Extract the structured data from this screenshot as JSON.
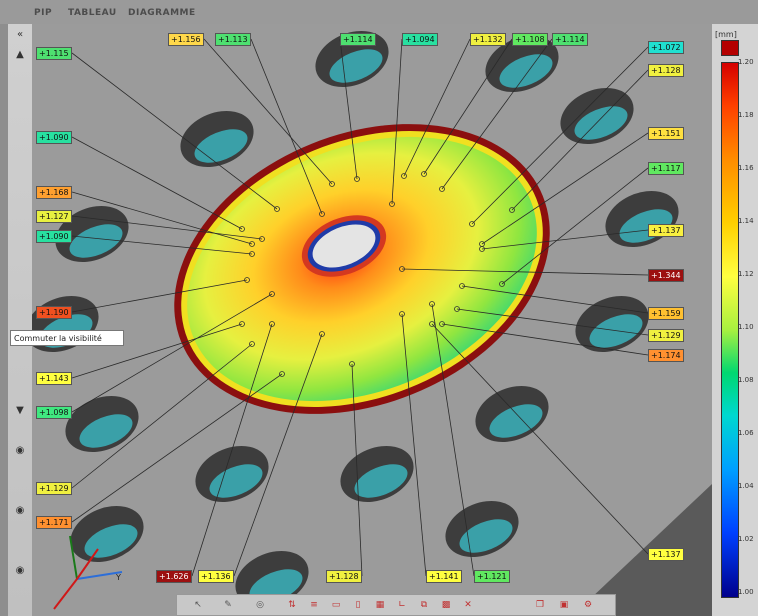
{
  "tabs": [
    "PIP",
    "TABLEAU",
    "DIAGRAMME"
  ],
  "legend": {
    "unit": "[mm]",
    "ticks": [
      "1.20",
      "1.18",
      "1.16",
      "1.14",
      "1.12",
      "1.10",
      "1.08",
      "1.06",
      "1.04",
      "1.02",
      "1.00"
    ],
    "max_swatch_color": "#b40000",
    "min_swatch_color": "#00008c"
  },
  "tooltip": {
    "text": "Commuter la visibilité"
  },
  "axis_label": "Y",
  "labels": [
    {
      "text": "+1.156",
      "color": "#ffd84a"
    },
    {
      "text": "+1.113",
      "color": "#4ee070"
    },
    {
      "text": "+1.114",
      "color": "#4ee070"
    },
    {
      "text": "+1.094",
      "color": "#28e0a0"
    },
    {
      "text": "+1.132",
      "color": "#f0f040"
    },
    {
      "text": "+1.108",
      "color": "#60e860"
    },
    {
      "text": "+1.114",
      "color": "#4ee070"
    },
    {
      "text": "+1.072",
      "color": "#20e0d0"
    },
    {
      "text": "+1.115",
      "color": "#4ee070"
    },
    {
      "text": "+1.128",
      "color": "#f0f040"
    },
    {
      "text": "+1.151",
      "color": "#ffe040"
    },
    {
      "text": "+1.090",
      "color": "#28e0a0"
    },
    {
      "text": "+1.117",
      "color": "#60e860"
    },
    {
      "text": "+1.168",
      "color": "#ffa030"
    },
    {
      "text": "+1.127",
      "color": "#e8f040"
    },
    {
      "text": "+1.090",
      "color": "#28e0a0"
    },
    {
      "text": "+1.137",
      "color": "#f8f040"
    },
    {
      "text": "+1.344",
      "color": "#9c1010"
    },
    {
      "text": "+1.190",
      "color": "#f05020"
    },
    {
      "text": "+1.159",
      "color": "#ffc030"
    },
    {
      "text": "+1.129",
      "color": "#f0f040"
    },
    {
      "text": "+1.174",
      "color": "#ff9030"
    },
    {
      "text": "+1.143",
      "color": "#ffff40"
    },
    {
      "text": "+1.098",
      "color": "#40e880"
    },
    {
      "text": "+1.129",
      "color": "#f0f040"
    },
    {
      "text": "+1.171",
      "color": "#ff9030"
    },
    {
      "text": "+1.137",
      "color": "#ffff40"
    },
    {
      "text": "+1.626",
      "color": "#9c1010"
    },
    {
      "text": "+1.136",
      "color": "#ffff40"
    },
    {
      "text": "+1.128",
      "color": "#f0f040"
    },
    {
      "text": "+1.141",
      "color": "#ffff40"
    },
    {
      "text": "+1.121",
      "color": "#60e860"
    }
  ]
}
